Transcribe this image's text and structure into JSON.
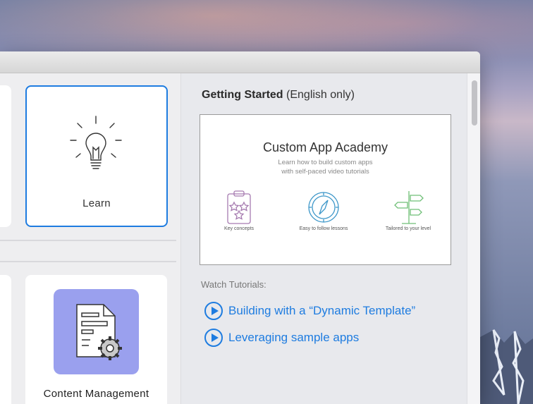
{
  "learn_card": {
    "label": "Learn",
    "icon": "lightbulb-icon"
  },
  "content_card": {
    "label": "Content Management",
    "icon": "document-gear-icon",
    "tile_color": "#9aa0ee"
  },
  "getting_started": {
    "title": "Getting Started",
    "note": "(English only)"
  },
  "preview": {
    "title": "Custom App Academy",
    "subtitle_line1": "Learn how to build custom apps",
    "subtitle_line2": "with self-paced video tutorials",
    "features": [
      {
        "caption": "Key concepts",
        "icon": "clipboard-stars-icon"
      },
      {
        "caption": "Easy to follow lessons",
        "icon": "compass-icon"
      },
      {
        "caption": "Tailored to your level",
        "icon": "signpost-icon"
      }
    ]
  },
  "tutorials": {
    "label": "Watch Tutorials:",
    "items": [
      {
        "label": "Building with a “Dynamic Template”"
      },
      {
        "label": "Leveraging sample apps"
      }
    ]
  },
  "colors": {
    "accent": "#1e7ce0"
  }
}
